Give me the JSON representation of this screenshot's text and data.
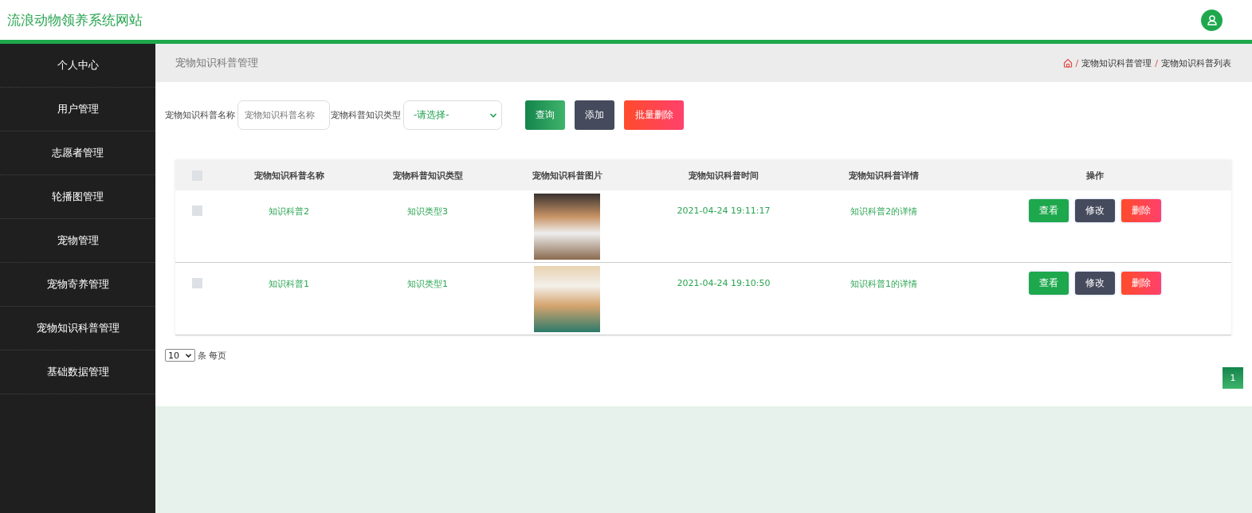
{
  "header": {
    "title": "流浪动物领养系统网站"
  },
  "sidebar": {
    "items": [
      {
        "label": "个人中心"
      },
      {
        "label": "用户管理"
      },
      {
        "label": "志愿者管理"
      },
      {
        "label": "轮播图管理"
      },
      {
        "label": "宠物管理"
      },
      {
        "label": "宠物寄养管理"
      },
      {
        "label": "宠物知识科普管理"
      },
      {
        "label": "基础数据管理"
      }
    ]
  },
  "page_title": "宠物知识科普管理",
  "breadcrumb": [
    {
      "separator": "/",
      "label": "宠物知识科普管理"
    },
    {
      "separator": "/",
      "label": "宠物知识科普列表"
    }
  ],
  "filters": {
    "name_label": "宠物知识科普名称",
    "name_placeholder": "宠物知识科普名称",
    "type_label": "宠物科普知识类型",
    "type_value": "-请选择-"
  },
  "buttons": [
    {
      "label": "查询",
      "kind": "search"
    },
    {
      "label": "添加",
      "kind": "add"
    },
    {
      "label": "批量删除",
      "kind": "delete"
    }
  ],
  "table": {
    "select_all_checked": false,
    "columns": [
      "宠物知识科普名称",
      "宠物科普知识类型",
      "宠物知识科普图片",
      "宠物知识科普时间",
      "宠物知识科普详情",
      "操作"
    ],
    "rows": [
      {
        "checked": false,
        "name": "知识科普2",
        "type": "知识类型3",
        "time": "2021-04-24 19:11:17",
        "detail": "知识科普2的详情",
        "actions": [
          "查看",
          "修改",
          "删除"
        ]
      },
      {
        "checked": false,
        "name": "知识科普1",
        "type": "知识类型1",
        "time": "2021-04-24 19:10:50",
        "detail": "知识科普1的详情",
        "actions": [
          "查看",
          "修改",
          "删除"
        ]
      }
    ]
  },
  "pagination": {
    "page_size": "10",
    "page_size_suffix": "条 每页",
    "pages": [
      {
        "label": "1",
        "selected": true
      }
    ]
  }
}
